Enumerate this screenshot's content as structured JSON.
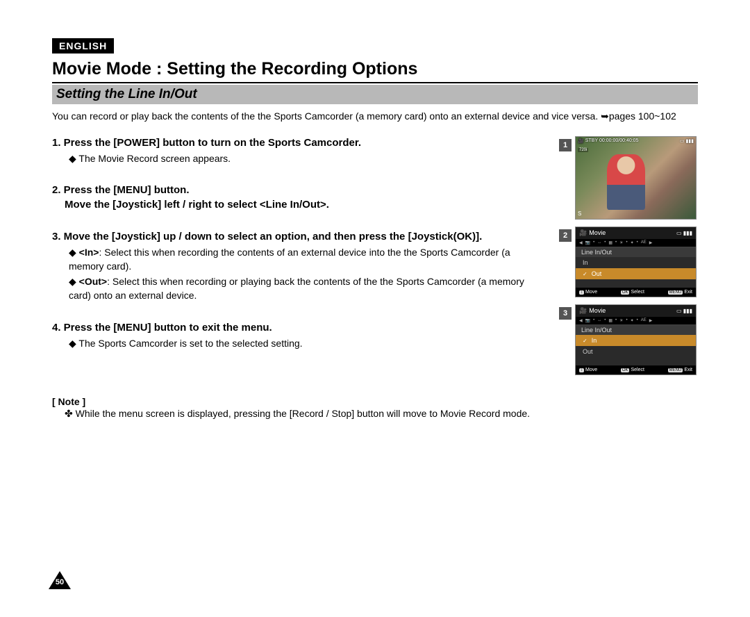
{
  "language_badge": "ENGLISH",
  "page_title": "Movie Mode : Setting the Recording Options",
  "section_title": "Setting the Line In/Out",
  "intro": "You can record or play back the contents of the the Sports Camcorder (a memory card) onto an external device and vice versa. ➥pages 100~102",
  "steps": {
    "s1": {
      "head": "1. Press the [POWER] button to turn on the Sports Camcorder.",
      "sub": "The Movie Record screen appears."
    },
    "s2": {
      "head_a": "2. Press the [MENU] button.",
      "head_b": "Move the [Joystick] left / right to select <Line In/Out>."
    },
    "s3": {
      "head": "3. Move the [Joystick] up / down to select an option, and then press the [Joystick(OK)].",
      "opt_in_label": "<In>",
      "opt_in_text": ": Select this when recording the contents of an external device into the the Sports Camcorder (a memory card).",
      "opt_out_label": "<Out>",
      "opt_out_text": ": Select this when recording or playing back the contents of the the Sports Camcorder (a memory card) onto an external device."
    },
    "s4": {
      "head": "4. Press the [MENU] button to exit the menu.",
      "sub": "The Sports Camcorder is set to the selected setting."
    }
  },
  "note": {
    "head": "[ Note ]",
    "body": "While the menu screen is displayed, pressing the [Record / Stop] button will move to Movie Record mode."
  },
  "screens": {
    "s1": {
      "stby": "STBY",
      "time": "00:00:00/00:40:05",
      "res": "720i",
      "sepia": "S"
    },
    "menu_mode": "Movie",
    "menu_title": "Line In/Out",
    "opt_in": "In",
    "opt_out": "Out",
    "foot_move": "Move",
    "foot_select": "Select",
    "foot_exit": "Exit",
    "foot_move_btn": "↕",
    "foot_select_btn": "OK",
    "foot_exit_btn": "MENU"
  },
  "page_number": "50",
  "nums": {
    "n1": "1",
    "n2": "2",
    "n3": "3"
  }
}
